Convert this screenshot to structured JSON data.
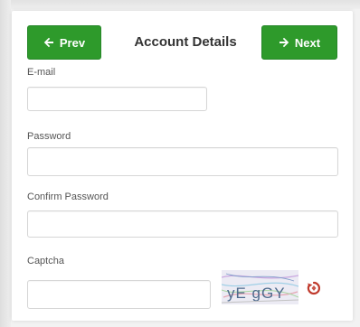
{
  "nav": {
    "prev_label": "Prev",
    "next_label": "Next",
    "title": "Account Details"
  },
  "fields": {
    "email_label": "E-mail",
    "password_label": "Password",
    "confirm_password_label": "Confirm Password",
    "captcha_label": "Captcha"
  },
  "captcha": {
    "text": "yE gGY"
  },
  "icons": {
    "prev": "arrow-left-icon",
    "next": "arrow-right-icon",
    "refresh": "refresh-icon"
  },
  "colors": {
    "button_green": "#2e9a2b",
    "refresh_red": "#c0392b"
  }
}
